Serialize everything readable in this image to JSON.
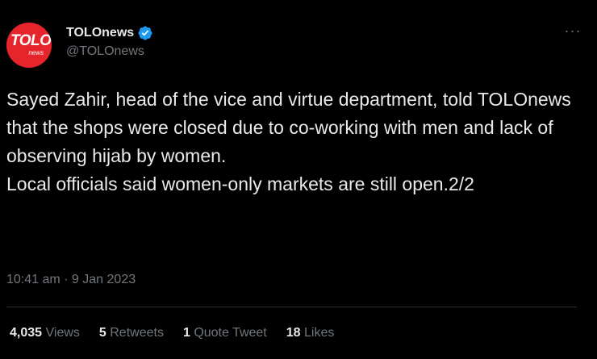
{
  "tweet": {
    "avatar": {
      "logo_main": "TOLO",
      "logo_sub": "news",
      "color": "#e5242b"
    },
    "display_name": "TOLOnews",
    "verified_icon": "verified-badge-icon",
    "handle": "@TOLOnews",
    "more_icon": "more-options-icon",
    "more_glyph": "···",
    "text": "Sayed Zahir, head of the vice and virtue department, told TOLOnews that the shops were closed due to co-working with men and lack of observing hijab by women.\nLocal officials said women-only markets are still open.2/2",
    "timestamp": "10:41 am · 9 Jan 2023",
    "stats": [
      {
        "count": "4,035",
        "label": "Views"
      },
      {
        "count": "5",
        "label": "Retweets"
      },
      {
        "count": "1",
        "label": "Quote Tweet"
      },
      {
        "count": "18",
        "label": "Likes"
      }
    ]
  },
  "colors": {
    "background": "#000000",
    "text_primary": "#e7e9ea",
    "text_secondary": "#71767b",
    "verified_blue": "#1d9bf0",
    "divider": "#2f3336"
  }
}
